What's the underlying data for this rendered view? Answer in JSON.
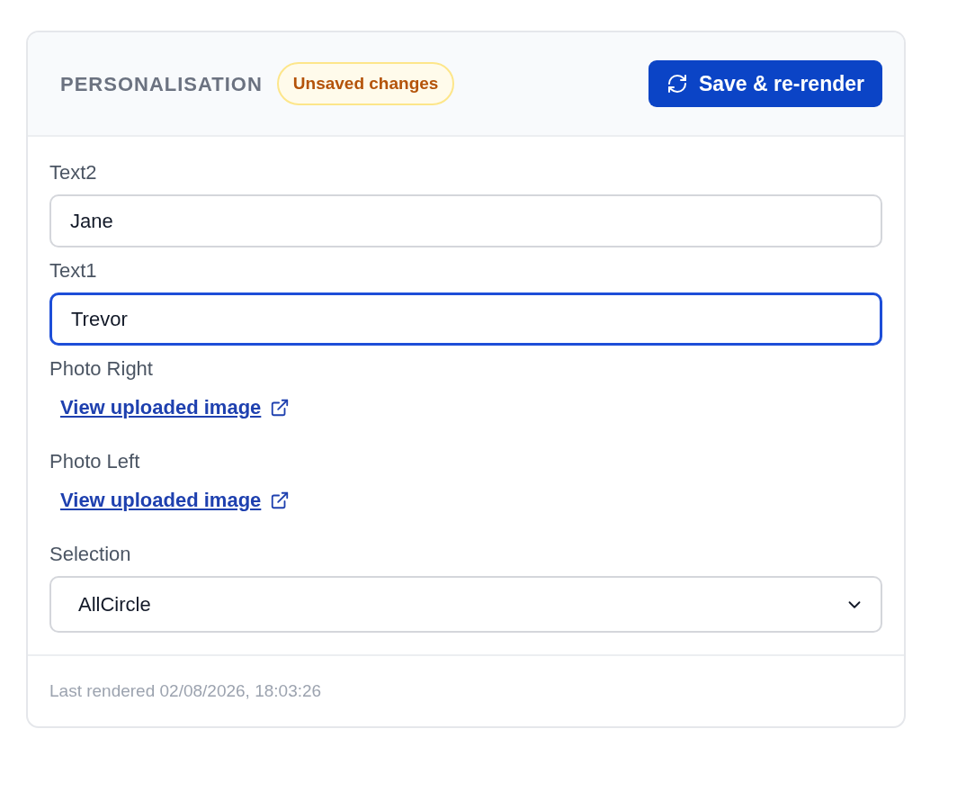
{
  "header": {
    "title": "PERSONALISATION",
    "badge": "Unsaved changes",
    "save_button": "Save & re-render"
  },
  "fields": [
    {
      "kind": "text",
      "label": "Text2",
      "value": "Jane",
      "focused": false
    },
    {
      "kind": "text",
      "label": "Text1",
      "value": "Trevor",
      "focused": true
    },
    {
      "kind": "link",
      "label": "Photo Right",
      "link": "View uploaded image"
    },
    {
      "kind": "link",
      "label": "Photo Left",
      "link": "View uploaded image"
    },
    {
      "kind": "select",
      "label": "Selection",
      "value": "AllCircle"
    }
  ],
  "footer": {
    "text": "Last rendered 02/08/2026, 18:03:26"
  }
}
